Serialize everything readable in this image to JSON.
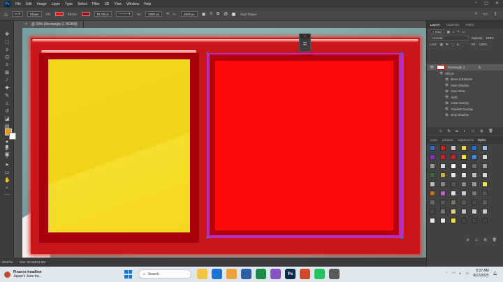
{
  "menubar": {
    "logo": "Ps",
    "items": [
      "File",
      "Edit",
      "Image",
      "Layer",
      "Type",
      "Select",
      "Filter",
      "3D",
      "View",
      "Window",
      "Help"
    ],
    "window_controls": [
      "–",
      "▢",
      "✕"
    ]
  },
  "options": {
    "mode": "Shape",
    "fill_label": "Fill:",
    "fill_color": "#ff0a0a",
    "stroke_label": "Stroke:",
    "stroke_width": "81.09 px",
    "width_label": "W:",
    "width_value": "1900 px",
    "height_label": "H:",
    "height_value": "1818 px",
    "align_edges": "Align Edges"
  },
  "document": {
    "tab_title": "@ 39% (Rectangle 3, RGB/8)",
    "tab_close": "×"
  },
  "status": {
    "zoom": "38.97%",
    "doc_info": "Doc: 31.5M/31.5M"
  },
  "layers_panel": {
    "tabs": [
      "Layers",
      "Channels",
      "Paths"
    ],
    "kind_label": "Kind",
    "blend_mode": "Normal",
    "opacity_label": "Opacity:",
    "opacity_value": "100%",
    "lock_label": "Lock:",
    "fill_label": "Fill:",
    "fill_value": "100%",
    "layer_name": "Rectangle 3",
    "fx_label": "fx",
    "effects_label": "Effects",
    "effects": [
      "Bevel & Emboss",
      "Inner Shadow",
      "Inner Glow",
      "Satin",
      "Color Overlay",
      "Gradient Overlay",
      "Drop Shadow"
    ]
  },
  "styles_panel": {
    "tabs": [
      "Learn",
      "Libraries",
      "Adjustments",
      "Styles"
    ],
    "swatches": [
      "#2b6dd6",
      "#d81f1f",
      "#c8c8c8",
      "#e6d84a",
      "#2b6dd6",
      "#8fbde8",
      "#8a2fc0",
      "#d81f1f",
      "#d81f1f",
      "#f0e040",
      "#3c8ee8",
      "#cfd8e0",
      "#9a9a9a",
      "#d8d8d8",
      "#ffffff",
      "#f0f0f0",
      "#707070",
      "#a0a0a0",
      "#3c6e3c",
      "#c9b040",
      "#e8e8e8",
      "#e0e0e0",
      "#bfbfbf",
      "#d8d8d8",
      "#bcbcbc",
      "#888888",
      "#555555",
      "#8a8a8a",
      "#999999",
      "#f6e24a",
      "#c07020",
      "#c060c0",
      "#dcdcdc",
      "#c8c8c8",
      "#777777",
      "#555555",
      "#6a6a6a",
      "#575757",
      "#7a7a5a",
      "#5a5a5a",
      "#4a4a4a",
      "#5f5f5f",
      "#4a4a4a",
      "#777777",
      "#e6d088",
      "#bfbfbf",
      "#d0d0d0",
      "#cccccc",
      "#eaeaea",
      "#e0e6ea",
      "#f3dc3a",
      "#444444",
      "#444444",
      "#444444"
    ]
  },
  "taskbar": {
    "news_title": "Finance headline",
    "news_sub": "Japan's June tra...",
    "search_label": "Search",
    "apps": [
      {
        "label": "",
        "color": "#f4c542"
      },
      {
        "label": "",
        "color": "#1a73d9"
      },
      {
        "label": "",
        "color": "#e8a33a"
      },
      {
        "label": "",
        "color": "#2d5ea8"
      },
      {
        "label": "",
        "color": "#1d8a4a"
      },
      {
        "label": "",
        "color": "#8a52c8"
      },
      {
        "label": "Ps",
        "color": "#0b2a4a"
      },
      {
        "label": "",
        "color": "#d04a2a"
      },
      {
        "label": "",
        "color": "#25c360"
      },
      {
        "label": "",
        "color": "#5a5a5a"
      }
    ],
    "time": "9:27 AM",
    "date": "8/12/2025"
  }
}
